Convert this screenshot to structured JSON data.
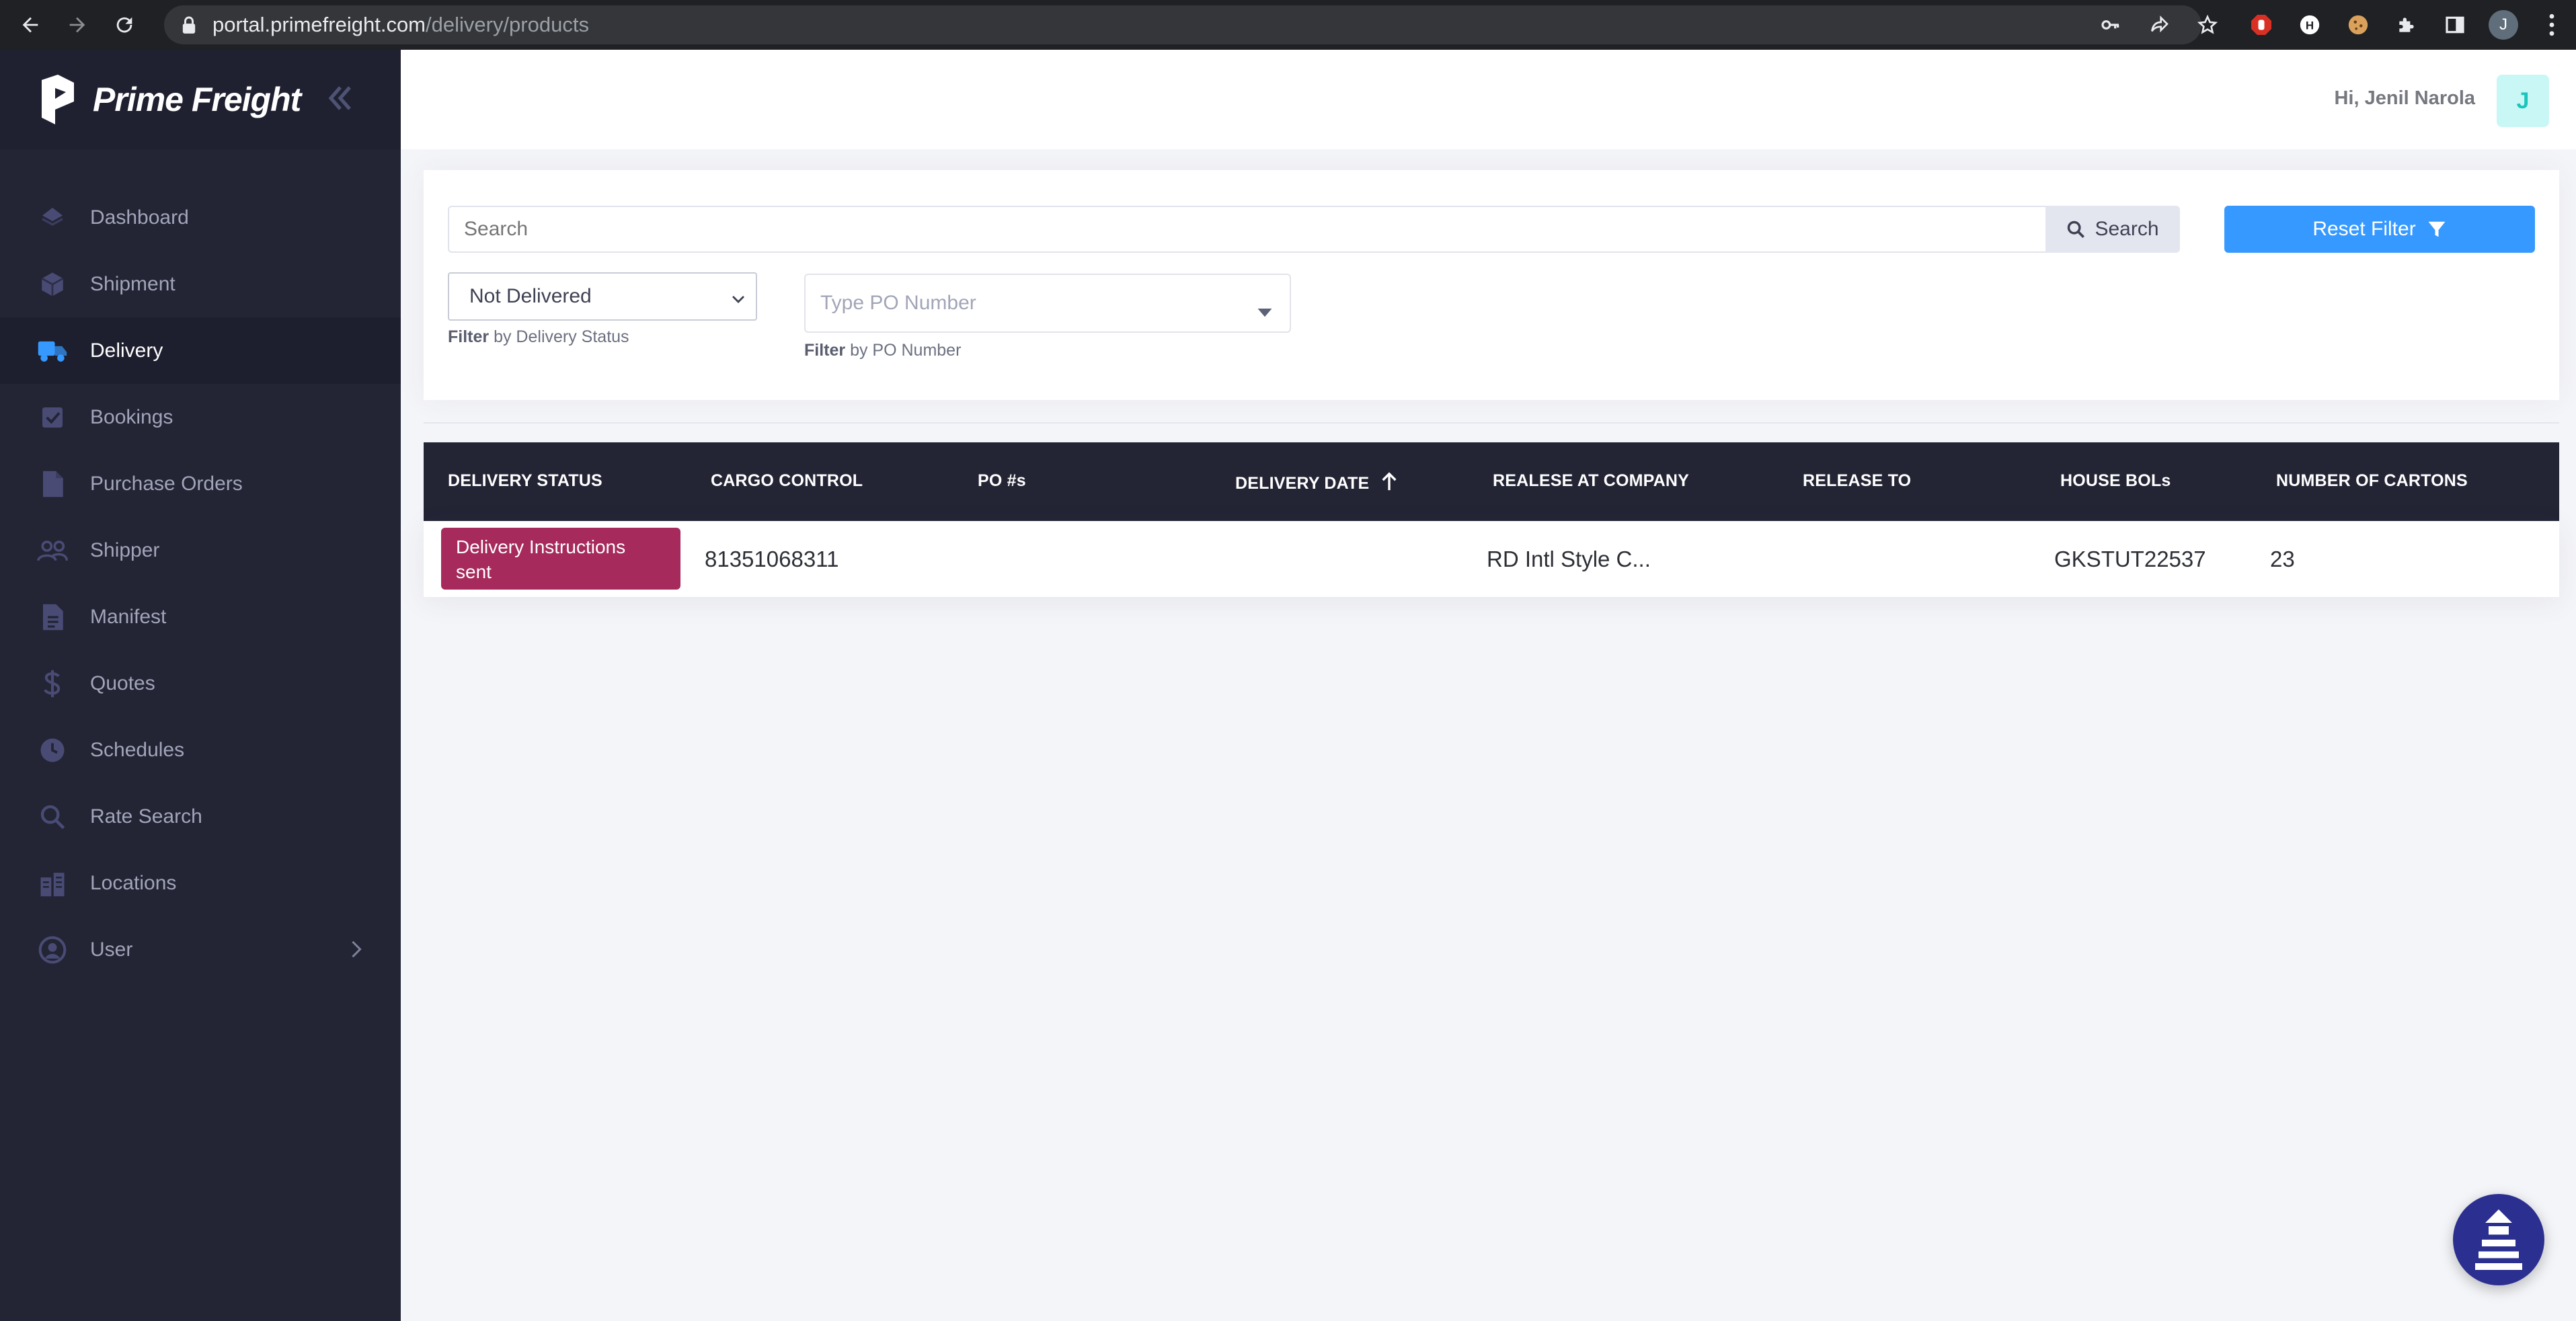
{
  "browser": {
    "url_host": "portal.primefreight.com",
    "url_path": "/delivery/products",
    "profile_initial": "J"
  },
  "sidebar": {
    "brand": "Prime Freight",
    "items": [
      {
        "label": "Dashboard",
        "icon": "diamond-icon"
      },
      {
        "label": "Shipment",
        "icon": "box-icon"
      },
      {
        "label": "Delivery",
        "icon": "truck-icon",
        "active": true
      },
      {
        "label": "Bookings",
        "icon": "checkbox-icon"
      },
      {
        "label": "Purchase Orders",
        "icon": "document-icon"
      },
      {
        "label": "Shipper",
        "icon": "users-icon"
      },
      {
        "label": "Manifest",
        "icon": "file-text-icon"
      },
      {
        "label": "Quotes",
        "icon": "dollar-icon"
      },
      {
        "label": "Schedules",
        "icon": "clock-icon"
      },
      {
        "label": "Rate Search",
        "icon": "search-icon"
      },
      {
        "label": "Locations",
        "icon": "buildings-icon"
      },
      {
        "label": "User",
        "icon": "user-circle-icon"
      }
    ]
  },
  "header": {
    "greeting": "Hi, Jenil Narola",
    "avatar_initial": "J"
  },
  "filters": {
    "search_placeholder": "Search",
    "search_button": "Search",
    "reset_button": "Reset Filter",
    "status_value": "Not Delivered",
    "status_hint_bold": "Filter",
    "status_hint": "by Delivery Status",
    "po_placeholder": "Type PO Number",
    "po_hint_bold": "Filter",
    "po_hint": "by PO Number"
  },
  "table": {
    "columns": [
      "DELIVERY STATUS",
      "CARGO CONTROL",
      "PO #s",
      "DELIVERY DATE",
      "REALESE AT COMPANY",
      "RELEASE TO",
      "HOUSE BOLs",
      "NUMBER OF CARTONS"
    ],
    "rows": [
      {
        "status": "Delivery Instructions sent",
        "cargo_control": "81351068311",
        "po": "",
        "delivery_date": "",
        "release_company": "RD Intl Style C...",
        "release_to": "",
        "house_bols": "GKSTUT22537",
        "cartons": "23"
      }
    ]
  },
  "colors": {
    "sidebar_bg": "#232535",
    "accent_blue": "#3699ff",
    "status_badge": "#a62a5c",
    "avatar_bg": "#c9f7f5"
  }
}
